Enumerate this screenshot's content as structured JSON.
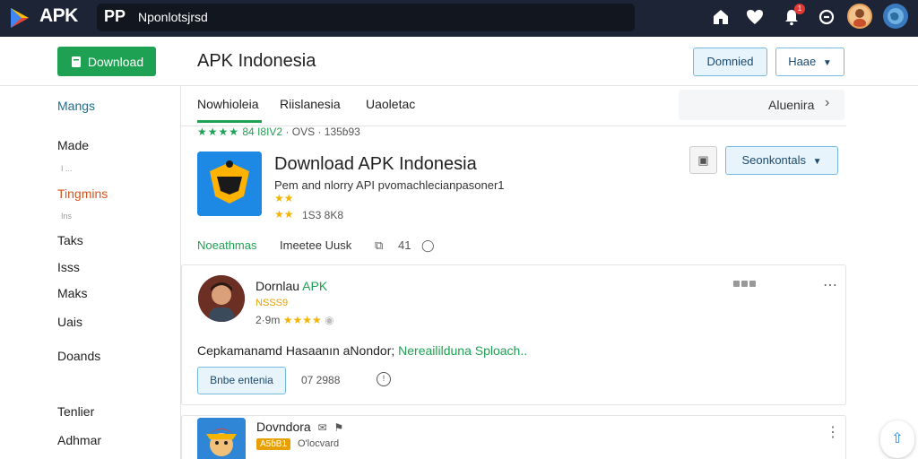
{
  "topbar": {
    "logo_text": "APK",
    "search_logo": "PP",
    "search_text": "Nponlotsjrsd",
    "icons": [
      "home-icon",
      "heart-icon",
      "bell-icon",
      "compass-icon",
      "user-avatar",
      "globe-icon"
    ],
    "notification_count": "1"
  },
  "header": {
    "download_button": "Download",
    "title": "APK Indonesia",
    "button_primary": "Domnied",
    "button_secondary": "Haae"
  },
  "sidebar": {
    "items": [
      {
        "label": "Mangs",
        "color": "#1e6e8c"
      },
      {
        "label": "Made",
        "color": "#222222"
      },
      {
        "label": "Tingmins",
        "color": "#d2541f"
      },
      {
        "label": "Taks",
        "color": "#222222"
      },
      {
        "label": "Isss",
        "color": "#222222"
      },
      {
        "label": "Maks",
        "color": "#222222"
      },
      {
        "label": "Uais",
        "color": "#222222"
      },
      {
        "label": "Doands",
        "color": "#222222"
      },
      {
        "label": "Tenlier",
        "color": "#222222"
      },
      {
        "label": "Adhmar",
        "color": "#222222"
      }
    ],
    "subs": [
      "I ...",
      "Ins"
    ]
  },
  "tabs": {
    "items": [
      "Nowhioleia",
      "Riislanesia",
      "Uaoletac"
    ],
    "right_label": "Aluenira"
  },
  "rating_strip": {
    "stars": "★★★★",
    "score": "84",
    "tag": "I8IV2",
    "stats": "· OVS · 135ɓ93"
  },
  "app": {
    "title": "Download APK Indonesia",
    "description": "Pem and nlorry API pvomachlecianpasoner1",
    "stars_1": "★★",
    "stars_2": "★★",
    "stars_2_text": "1S3 8K8",
    "button": "Seonkontals",
    "meta": {
      "link": "Noeathmas",
      "text": "Imeetee Uusk",
      "count": "41"
    }
  },
  "review": {
    "name": "Dornlau",
    "name_highlight": "APK",
    "tag": "NSSS9",
    "time": "2·9m",
    "stars": "★★★★",
    "text": "Cepkamanamd Hasaanın aNondor;",
    "text_highlight": "Nereaililduna Sploach..",
    "button": "Bnbe entenia",
    "date": "07 2988"
  },
  "item2": {
    "name": "Dovndora",
    "badge": "A5ɓB1",
    "meta": "O'locvard"
  }
}
